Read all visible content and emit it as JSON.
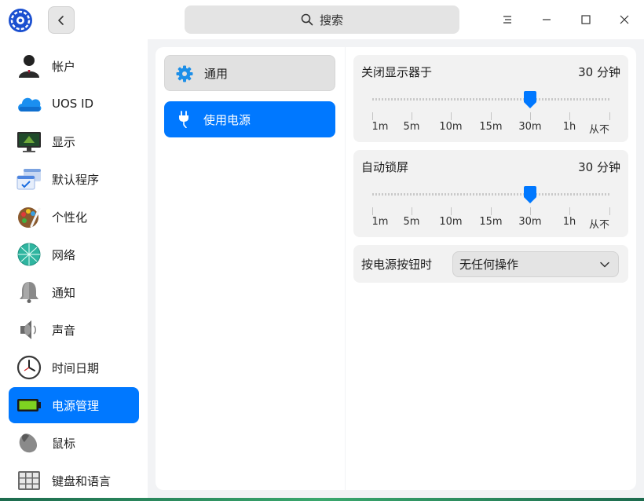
{
  "window": {
    "search_placeholder": "搜索",
    "colors": {
      "accent": "#0078ff",
      "window_bg": "#f2f3f5"
    }
  },
  "sidebar": {
    "items": [
      {
        "label": "帐户",
        "icon": "account-icon",
        "active": false
      },
      {
        "label": "UOS ID",
        "icon": "cloud-icon",
        "active": false
      },
      {
        "label": "显示",
        "icon": "display-icon",
        "active": false
      },
      {
        "label": "默认程序",
        "icon": "default-apps-icon",
        "active": false
      },
      {
        "label": "个性化",
        "icon": "palette-icon",
        "active": false
      },
      {
        "label": "网络",
        "icon": "network-icon",
        "active": false
      },
      {
        "label": "通知",
        "icon": "bell-icon",
        "active": false
      },
      {
        "label": "声音",
        "icon": "speaker-icon",
        "active": false
      },
      {
        "label": "时间日期",
        "icon": "clock-icon",
        "active": false
      },
      {
        "label": "电源管理",
        "icon": "battery-icon",
        "active": true
      },
      {
        "label": "鼠标",
        "icon": "mouse-icon",
        "active": false
      },
      {
        "label": "键盘和语言",
        "icon": "keyboard-icon",
        "active": false
      }
    ]
  },
  "subnav": {
    "general": "通用",
    "battery": "使用电源"
  },
  "settings": {
    "monitor_off": {
      "title": "关闭显示器于",
      "value": "30 分钟",
      "ticks": [
        "1m",
        "5m",
        "10m",
        "15m",
        "30m",
        "1h",
        "从不"
      ],
      "selected_index": 4
    },
    "auto_lock": {
      "title": "自动锁屏",
      "value": "30 分钟",
      "ticks": [
        "1m",
        "5m",
        "10m",
        "15m",
        "30m",
        "1h",
        "从不"
      ],
      "selected_index": 4
    },
    "power_button": {
      "title": "按电源按钮时",
      "selected": "无任何操作"
    }
  }
}
